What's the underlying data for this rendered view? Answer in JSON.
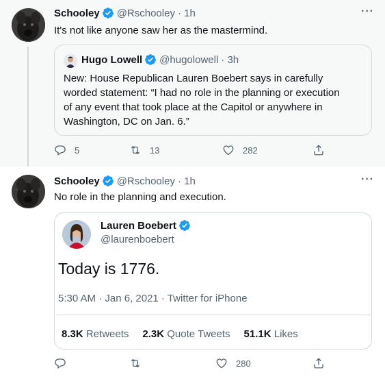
{
  "tweet1": {
    "author_name": "Schooley",
    "author_handle": "@Rschooley",
    "time": "· 1h",
    "text": "It's not like anyone saw her as the mastermind.",
    "quote": {
      "author_name": "Hugo Lowell",
      "author_handle": "@hugolowell",
      "time": "· 3h",
      "lines": [
        "New: House Republican Lauren Boebert says in carefully",
        "worded statement: “I had no role in the planning or execution",
        "of any event that took place at the Capitol or anywhere in",
        "Washington, DC on Jan. 6.”"
      ]
    },
    "replies": "5",
    "retweets": "13",
    "likes": "282"
  },
  "tweet2": {
    "author_name": "Schooley",
    "author_handle": "@Rschooley",
    "time": "· 1h",
    "text": "No role in the planning and execution.",
    "embed": {
      "author_name": "Lauren Boebert",
      "author_handle": "@laurenboebert",
      "text": "Today is 1776.",
      "meta": "5:30 AM · Jan 6, 2021 · Twitter for iPhone",
      "retweets_count": "8.3K",
      "retweets_label": "Retweets",
      "quotes_count": "2.3K",
      "quotes_label": "Quote Tweets",
      "likes_count": "51.1K",
      "likes_label": "Likes"
    },
    "likes": "280"
  },
  "colors": {
    "accent": "#1d9bf0",
    "secondary_text": "#536471",
    "border": "#cfd9de",
    "thread_bg": "#f7f9f9"
  },
  "icons": [
    "verified-badge-icon",
    "more-options-icon",
    "reply-icon",
    "retweet-icon",
    "like-icon",
    "share-icon"
  ]
}
